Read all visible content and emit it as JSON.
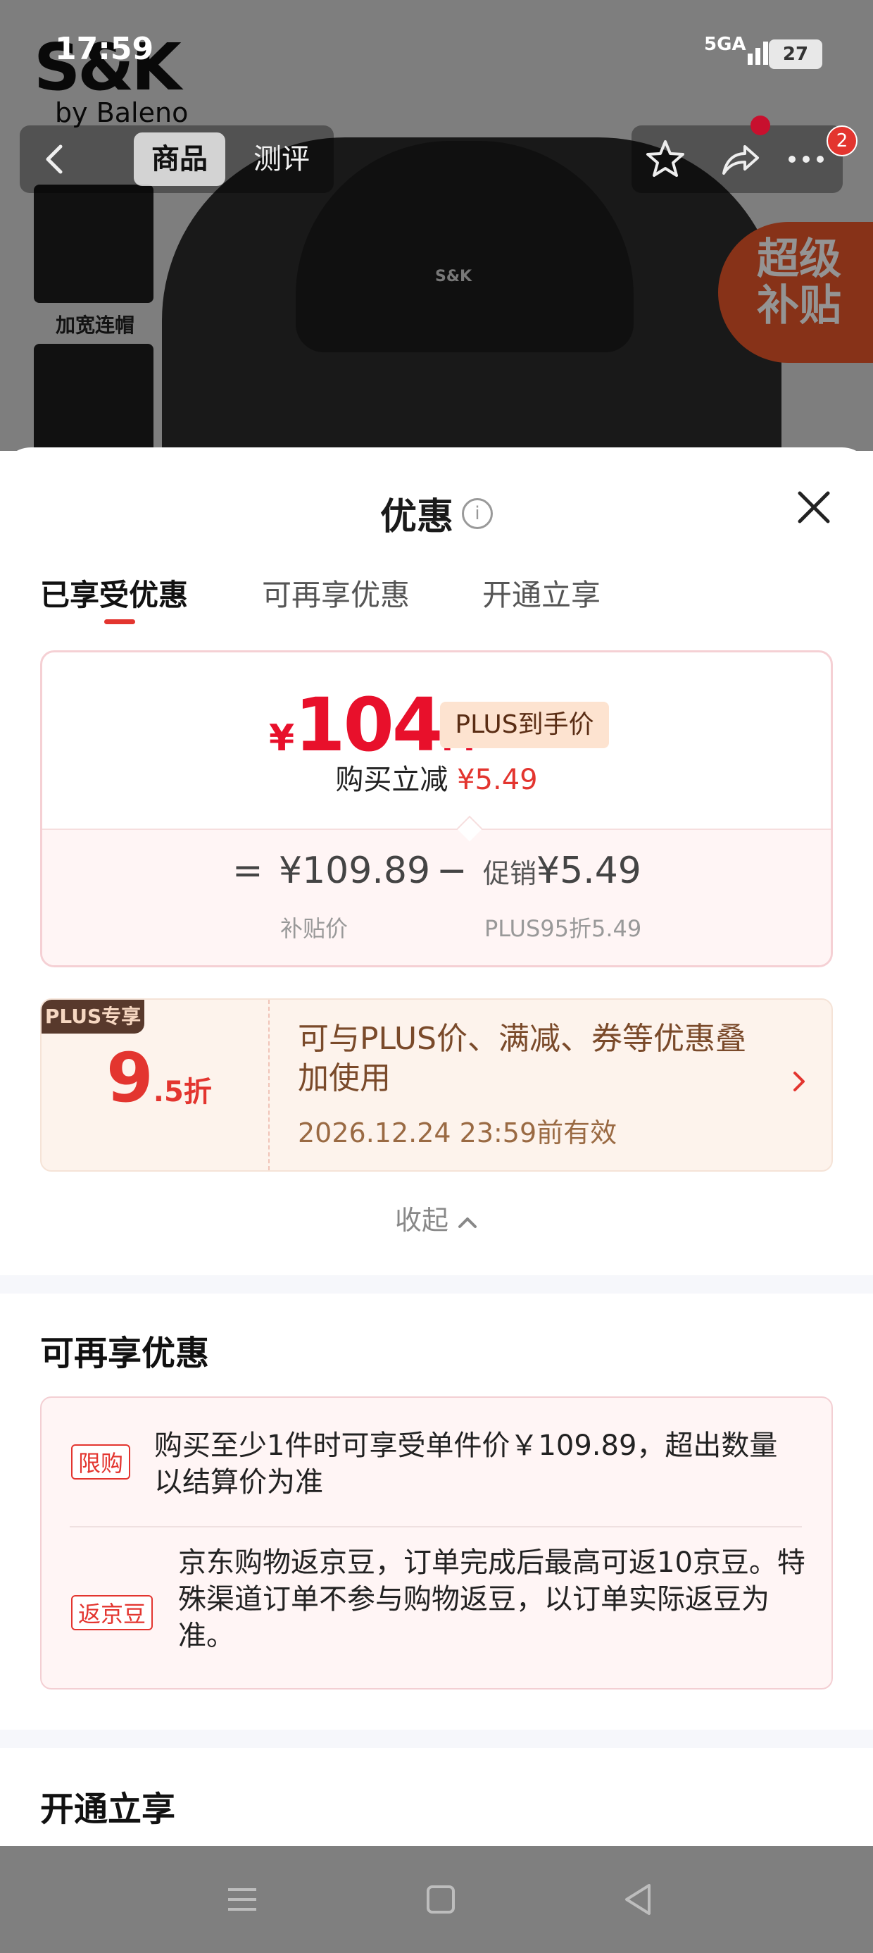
{
  "status_bar": {
    "time": "17:59",
    "network": "5G",
    "network_sub": "A",
    "battery": "27"
  },
  "product_bg": {
    "brand": "S&K",
    "brand_sub": "by Baleno",
    "collar_logo": "S&K",
    "thumb_label": "加宽连帽",
    "subsidy_badge_line1": "超级",
    "subsidy_badge_line2": "补贴"
  },
  "topbar": {
    "tab_goods": "商品",
    "tab_review": "测评",
    "message_count": "2"
  },
  "sheet": {
    "title": "优惠",
    "info_glyph": "i",
    "tabs": [
      {
        "label": "已享受优惠"
      },
      {
        "label": "可再享优惠"
      },
      {
        "label": "开通立享"
      }
    ],
    "price_card": {
      "currency": "¥",
      "price_int": "104",
      "price_dec": ".4",
      "plus_tag": "PLUS到手价",
      "reduce_label": "购买立减",
      "reduce_value": "¥5.49",
      "equals": "=",
      "subsidy_price": "¥109.89",
      "subsidy_label": "补贴价",
      "minus": "−",
      "promo_label": "促销",
      "promo_value": "¥5.49",
      "promo_sub": "PLUS95折5.49"
    },
    "plus_card": {
      "badge": "PLUS专享",
      "discount_num": "9",
      "discount_suffix": ".5折",
      "desc": "可与PLUS价、满减、券等优惠叠加使用",
      "valid": "2026.12.24 23:59前有效"
    },
    "collapse_label": "收起",
    "extra_section": {
      "title": "可再享优惠",
      "items": [
        {
          "tag": "限购",
          "text": "购买至少1件时可享受单件价￥109.89，超出数量以结算价为准"
        },
        {
          "tag": "返京豆",
          "text": "京东购物返京豆，订单完成后最高可返10京豆。特殊渠道订单不参与购物返豆，以订单实际返豆为准。"
        }
      ]
    },
    "open_section": {
      "title": "开通立享"
    }
  },
  "colors": {
    "accent_red": "#e3352f",
    "price_red": "#e8102b",
    "plus_brown": "#58392c"
  }
}
